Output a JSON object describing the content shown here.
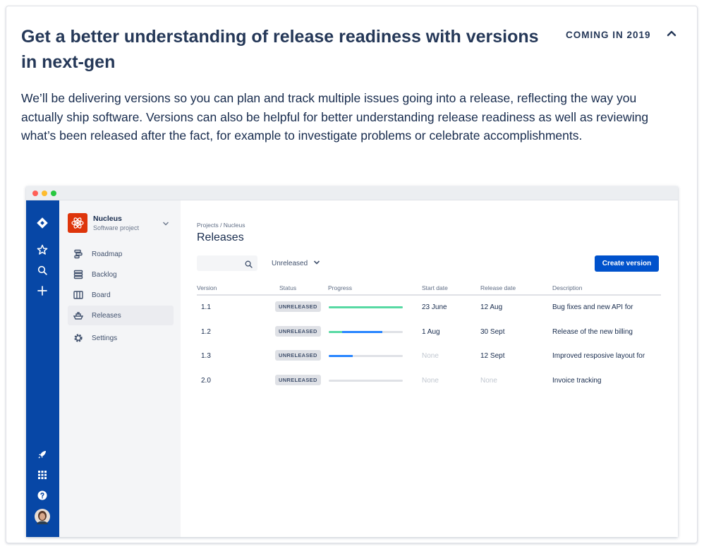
{
  "card": {
    "title": "Get a better understanding of release readiness with versions in next-gen",
    "badge": "COMING IN 2019",
    "description": "We’ll be delivering versions so you can plan and track multiple issues going into a release, reflecting the way you actually ship software. Versions can also be helpful for better understanding release readiness as well as reviewing what’s been released after the fact, for example to investigate problems or celebrate accomplishments."
  },
  "mock": {
    "window_dots": [
      "#ff5f57",
      "#febc2e",
      "#28c840"
    ],
    "colors": {
      "global_nav": "#0747a6",
      "primary_button": "#0052cc",
      "progress_done": "#57d9a3",
      "progress_in_progress": "#2684ff"
    },
    "project": {
      "name": "Nucleus",
      "type": "Software project"
    },
    "nav_items": [
      {
        "label": "Roadmap",
        "icon": "roadmap-icon"
      },
      {
        "label": "Backlog",
        "icon": "backlog-icon"
      },
      {
        "label": "Board",
        "icon": "board-icon"
      },
      {
        "label": "Releases",
        "icon": "ship-icon",
        "active": true
      },
      {
        "label": "Settings",
        "icon": "gear-icon"
      }
    ],
    "breadcrumb": "Projects / Nucleus",
    "page_title": "Releases",
    "filter_value": "Unreleased",
    "create_button": "Create version",
    "columns": [
      "Version",
      "Status",
      "Progress",
      "Start date",
      "Release date",
      "Description"
    ],
    "rows": [
      {
        "version": "1.1",
        "status": "UNRELEASED",
        "progress_done": 1.0,
        "progress_in_progress": 0.0,
        "start_date": "23 June",
        "release_date": "12 Aug",
        "description": "Bug fixes and new API for"
      },
      {
        "version": "1.2",
        "status": "UNRELEASED",
        "progress_done": 0.18,
        "progress_in_progress": 0.54,
        "start_date": "1 Aug",
        "release_date": "30 Sept",
        "description": "Release of the new billing"
      },
      {
        "version": "1.3",
        "status": "UNRELEASED",
        "progress_done": 0.0,
        "progress_in_progress": 0.32,
        "start_date": "None",
        "release_date": "12 Sept",
        "description": "Improved resposive layout for"
      },
      {
        "version": "2.0",
        "status": "UNRELEASED",
        "progress_done": 0.0,
        "progress_in_progress": 0.0,
        "start_date": "None",
        "release_date": "None",
        "description": "Invoice tracking"
      }
    ]
  }
}
